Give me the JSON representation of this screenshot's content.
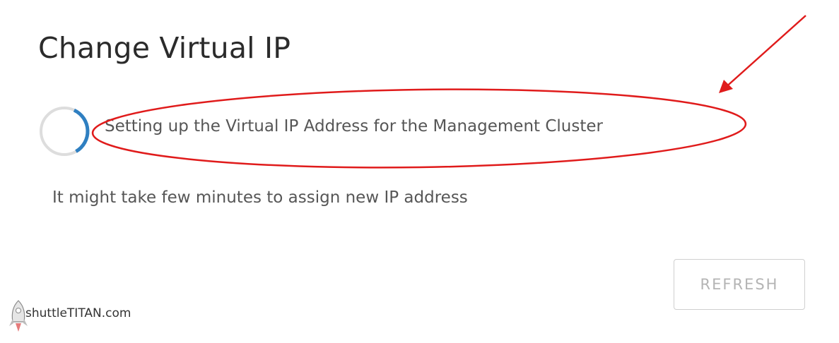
{
  "dialog": {
    "title": "Change Virtual IP",
    "status_message": "Setting up the Virtual IP Address for the Management Cluster",
    "info_message": "It might take few minutes to assign new IP address",
    "refresh_label": "REFRESH"
  },
  "spinner": {
    "icon": "loading-spinner-icon",
    "track_color": "#dddddd",
    "arc_color": "#2f7fc1"
  },
  "annotation": {
    "color": "#e01b1b"
  },
  "watermark": {
    "text": "shuttleTITAN.com"
  }
}
